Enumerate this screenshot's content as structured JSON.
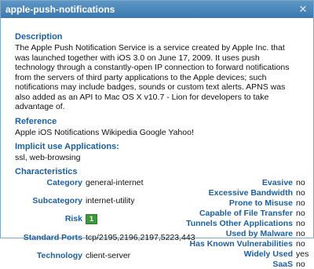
{
  "window": {
    "title": "apple-push-notifications"
  },
  "description": {
    "heading": "Description",
    "text": "The Apple Push Notification Service is a service created by Apple Inc. that was launched together with iOS 3.0 on June 17, 2009. It uses push technology through a constantly-open IP connection to forward notifications from the servers of third party applications to the Apple devices; such notifications may include badges, sounds or custom text alerts. APNS was also added as an API to Mac OS X v10.7 - Lion for developers to take advantage of."
  },
  "reference": {
    "heading": "Reference",
    "links": [
      "Apple iOS Notifications",
      "Wikipedia",
      "Google",
      "Yahoo!"
    ]
  },
  "implicit": {
    "heading": "Implicit use Applications:",
    "text": "ssl, web-browsing"
  },
  "characteristics": {
    "heading": "Characteristics",
    "left": [
      {
        "key": "Category",
        "value": "general-internet"
      },
      {
        "key": "Subcategory",
        "value": "internet-utility"
      },
      {
        "key": "Risk",
        "value": "1"
      },
      {
        "key": "Standard Ports",
        "value": "tcp/2195,2196,2197,5223,443"
      },
      {
        "key": "Technology",
        "value": "client-server"
      }
    ],
    "right": [
      {
        "key": "Evasive",
        "value": "no"
      },
      {
        "key": "Excessive Bandwidth",
        "value": "no"
      },
      {
        "key": "Prone to Misuse",
        "value": "no"
      },
      {
        "key": "Capable of File Transfer",
        "value": "no"
      },
      {
        "key": "Tunnels Other Applications",
        "value": "no"
      },
      {
        "key": "Used by Malware",
        "value": "no"
      },
      {
        "key": "Has Known Vulnerabilities",
        "value": "no"
      },
      {
        "key": "Widely Used",
        "value": "yes"
      },
      {
        "key": "SaaS",
        "value": "no"
      }
    ]
  },
  "colors": {
    "titlebar": "#3b78ac",
    "heading": "#1c5fa0",
    "risk_badge": "#3a9a3a"
  },
  "icons": {
    "close": "close-icon"
  }
}
